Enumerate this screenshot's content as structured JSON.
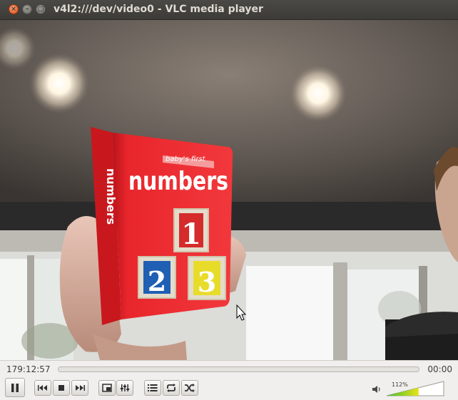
{
  "window": {
    "title": "v4l2:///dev/video0 - VLC media player",
    "close_glyph": "×",
    "minimize_glyph": "–",
    "maximize_glyph": "□"
  },
  "video": {
    "book_title": "numbers",
    "book_subtitle": "baby's first",
    "book_spine": "numbers",
    "block_1": "1",
    "block_2": "2",
    "block_3": "3"
  },
  "controls": {
    "elapsed": "179:12:57",
    "total": "00:00",
    "seek_fraction": 0,
    "volume_label": "112%",
    "volume_fraction": 0.56,
    "buttons": [
      {
        "name": "pause-button",
        "icon": "pause-icon"
      },
      {
        "name": "previous-button",
        "icon": "previous-icon"
      },
      {
        "name": "stop-button",
        "icon": "stop-icon"
      },
      {
        "name": "next-button",
        "icon": "next-icon"
      },
      {
        "name": "fullscreen-button",
        "icon": "fullscreen-icon"
      },
      {
        "name": "extended-settings-button",
        "icon": "equalizer-icon"
      },
      {
        "name": "playlist-button",
        "icon": "playlist-icon"
      },
      {
        "name": "loop-button",
        "icon": "loop-icon"
      },
      {
        "name": "random-button",
        "icon": "shuffle-icon"
      }
    ],
    "colors": {
      "volume_green": "#3fbf2a",
      "volume_yellow": "#e8e21a"
    }
  }
}
